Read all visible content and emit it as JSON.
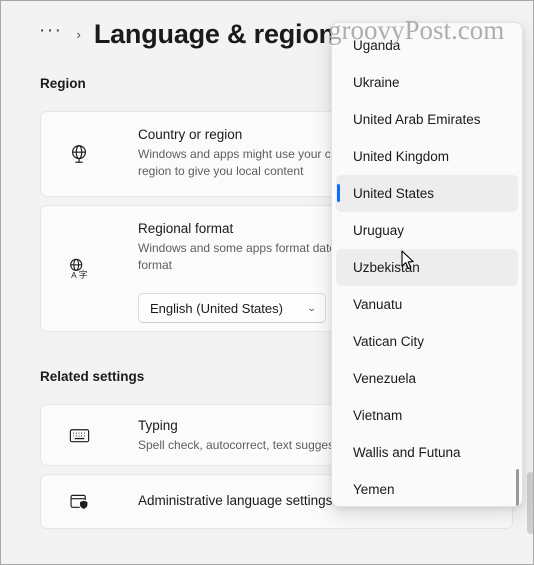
{
  "window": {
    "watermark": "groovyPost.com"
  },
  "header": {
    "overflow_label": "···",
    "separator": "›",
    "title": "Language & region"
  },
  "main": {
    "sections": [
      {
        "heading": "Region"
      },
      {
        "heading": "Related settings"
      }
    ],
    "cards": [
      {
        "id": "country-or-region",
        "icon": "globe-icon",
        "title": "Country or region",
        "subtitle": "Windows and apps might use your country or region to give you local content"
      },
      {
        "id": "regional-format",
        "icon": "language-globe-icon",
        "title": "Regional format",
        "subtitle": "Windows and some apps format dates and regional format",
        "combo_value": "English (United States)",
        "combo_chevron": "⌄"
      },
      {
        "id": "typing",
        "icon": "keyboard-icon",
        "title": "Typing",
        "subtitle": "Spell check, autocorrect, text suggestions"
      },
      {
        "id": "administrative-language-settings",
        "icon": "admin-shield-icon",
        "title": "Administrative language settings",
        "subtitle": ""
      }
    ]
  },
  "dropdown": {
    "name": "country-or-region-dropdown",
    "selected": "United States",
    "hovered": "Uzbekistan",
    "accent_color": "#0d6efd",
    "highlight_color": "#ededed",
    "items": [
      {
        "label": "Uganda",
        "state": "normal"
      },
      {
        "label": "Ukraine",
        "state": "normal"
      },
      {
        "label": "United Arab Emirates",
        "state": "normal"
      },
      {
        "label": "United Kingdom",
        "state": "normal"
      },
      {
        "label": "United States",
        "state": "selected"
      },
      {
        "label": "Uruguay",
        "state": "normal"
      },
      {
        "label": "Uzbekistan",
        "state": "hover"
      },
      {
        "label": "Vanuatu",
        "state": "normal"
      },
      {
        "label": "Vatican City",
        "state": "normal"
      },
      {
        "label": "Venezuela",
        "state": "normal"
      },
      {
        "label": "Vietnam",
        "state": "normal"
      },
      {
        "label": "Wallis and Futuna",
        "state": "normal"
      },
      {
        "label": "Yemen",
        "state": "normal"
      }
    ]
  }
}
